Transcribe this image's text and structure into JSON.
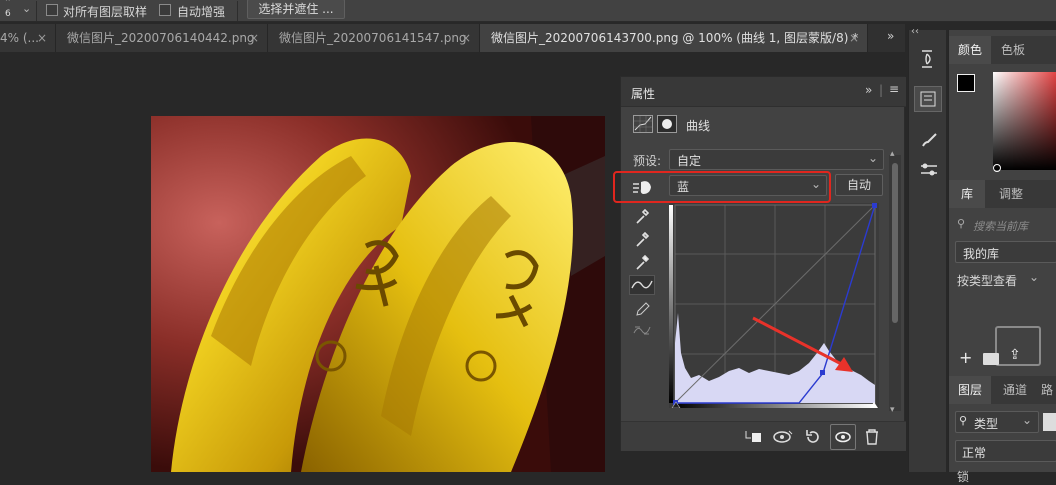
{
  "options_bar": {
    "value": "6",
    "sample_all_layers": "对所有图层取样",
    "auto_enhance": "自动增强",
    "select_mask_button": "选择并遮住 ..."
  },
  "tabs": [
    {
      "label": "4% (...",
      "close": "×"
    },
    {
      "label": "微信图片_20200706140442.png",
      "close": "×"
    },
    {
      "label": "微信图片_20200706141547.png",
      "close": "×"
    },
    {
      "label": "微信图片_20200706143700.png @ 100% (曲线 1, 图层蒙版/8) *",
      "close": "×"
    }
  ],
  "tab_overflow": "»",
  "properties": {
    "panel_title": "属性",
    "adjustment_name": "曲线",
    "preset_label": "预设:",
    "preset_value": "自定",
    "channel_value": "蓝",
    "auto_button": "自动"
  },
  "right_panel": {
    "color_tab": "颜色",
    "swatches_tab": "色板",
    "library_tab": "库",
    "adjust_tab": "调整",
    "search_placeholder": "搜索当前库",
    "my_library": "我的库",
    "view_by_type": "按类型查看",
    "layers_tab": "图层",
    "channels_tab": "通道",
    "paths_tab": "路",
    "kind_filter": "类型",
    "blend_mode": "正常",
    "opacity_partial": "锁"
  },
  "colors": {
    "accent_red": "#e0261e",
    "curve_blue": "#2b3bd0",
    "histogram": "#d8d8f4",
    "arrow_red": "#e8322a"
  }
}
